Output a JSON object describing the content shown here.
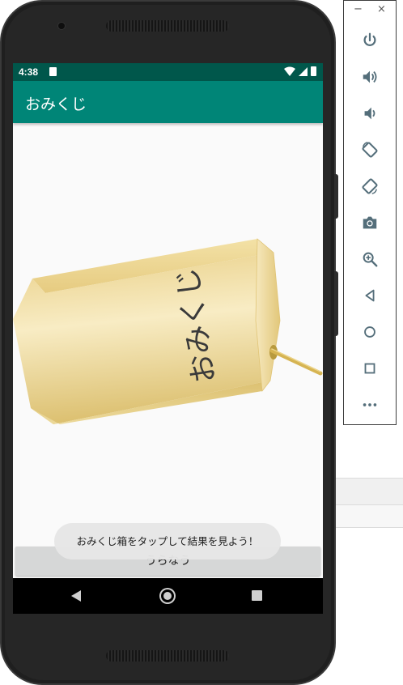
{
  "status_bar": {
    "time": "4:38"
  },
  "app_bar": {
    "title": "おみくじ"
  },
  "omikuji_box": {
    "label": "おみくじ"
  },
  "main_button": {
    "label": "うらなう"
  },
  "toast": {
    "message": "おみくじ箱をタップして結果を見よう！"
  },
  "emulator_toolbar": {
    "minimize_label": "−",
    "close_label": "×",
    "buttons": [
      "power",
      "volume-up",
      "volume-down",
      "rotate-left",
      "rotate-right",
      "screenshot",
      "zoom",
      "back",
      "home",
      "overview",
      "more"
    ]
  },
  "colors": {
    "status_bar": "#00574b",
    "app_bar": "#008577",
    "box_light": "#f6e7b4",
    "box_mid": "#ead189",
    "box_dark": "#d9bd6f",
    "stick": "#c9a642"
  }
}
